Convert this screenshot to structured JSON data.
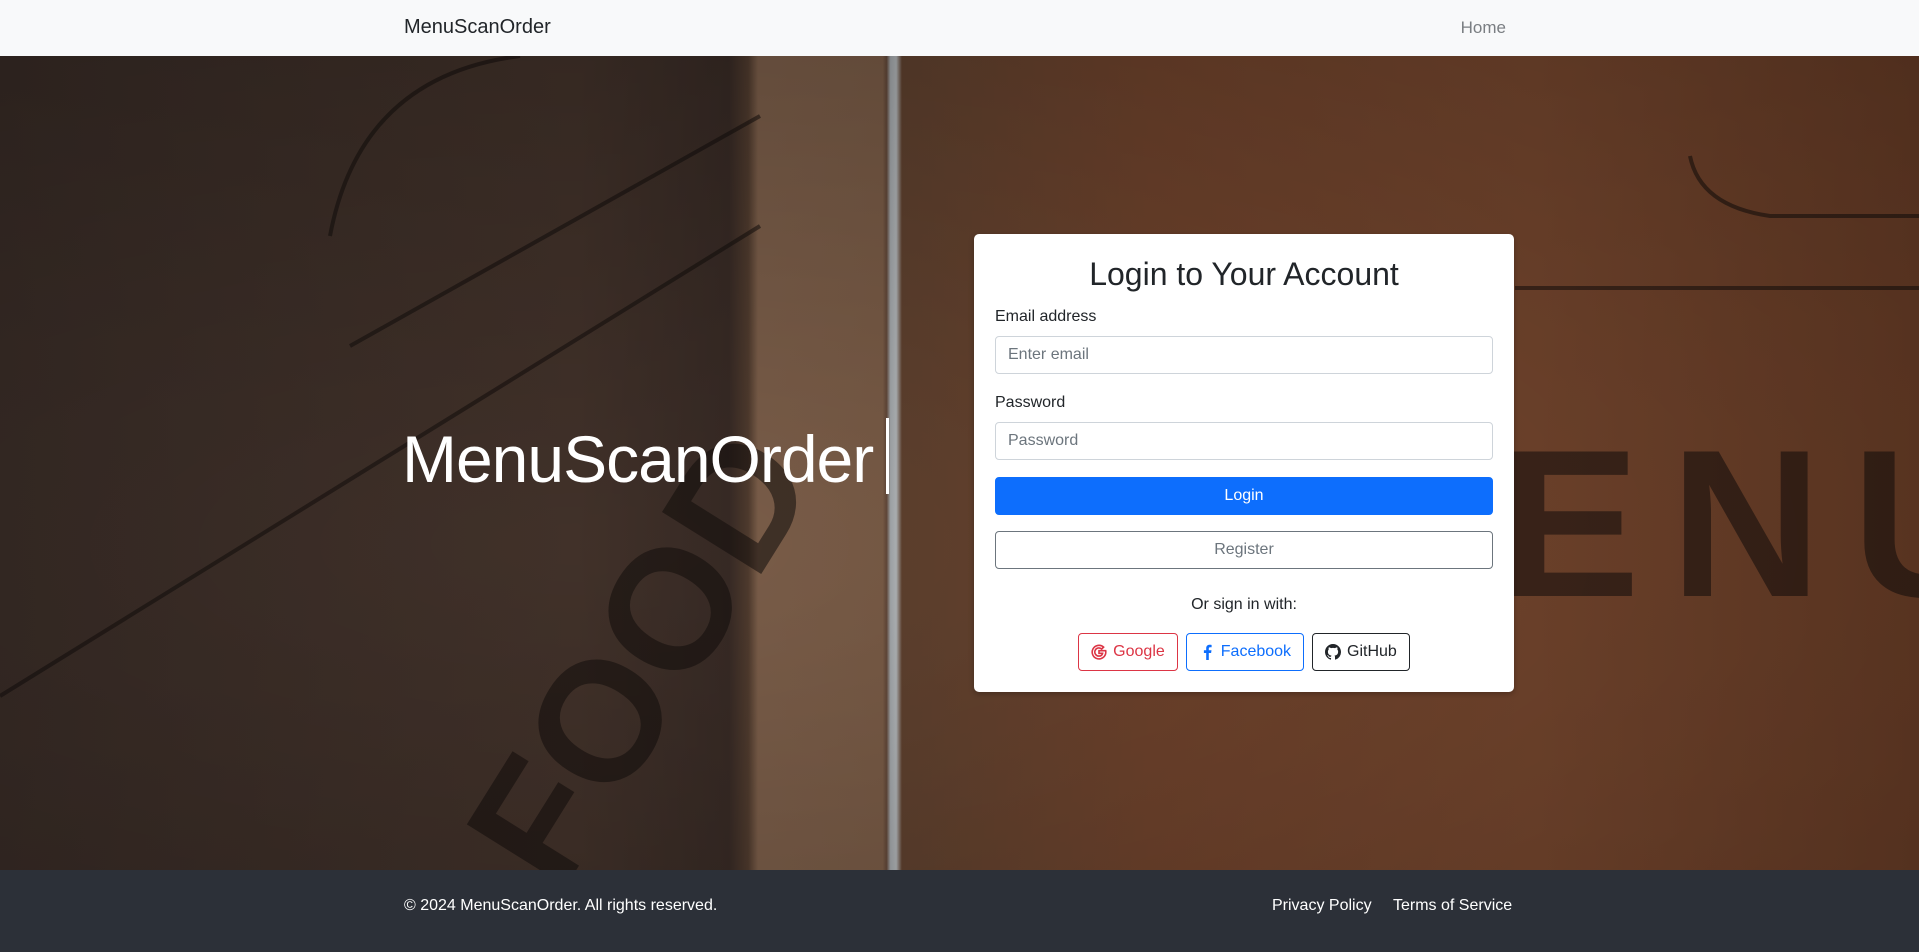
{
  "navbar": {
    "brand": "MenuScanOrder",
    "home_link": "Home"
  },
  "hero": {
    "title": "MenuScanOrder"
  },
  "login_card": {
    "title": "Login to Your Account",
    "email_label": "Email address",
    "email_placeholder": "Enter email",
    "email_value": "",
    "password_label": "Password",
    "password_placeholder": "Password",
    "password_value": "",
    "login_button": "Login",
    "register_button": "Register",
    "or_text": "Or sign in with:",
    "social": [
      {
        "label": "Google",
        "icon": "google-icon",
        "color": "#dc3545"
      },
      {
        "label": "Facebook",
        "icon": "facebook-icon",
        "color": "#0d6efd"
      },
      {
        "label": "GitHub",
        "icon": "github-icon",
        "color": "#212529"
      }
    ]
  },
  "footer": {
    "copyright": "© 2024 MenuScanOrder. All rights reserved.",
    "links": [
      "Privacy Policy",
      "Terms of Service"
    ]
  },
  "colors": {
    "primary": "#0d6efd",
    "navbar_bg": "#f8f9fa",
    "footer_bg": "#2c3038"
  }
}
